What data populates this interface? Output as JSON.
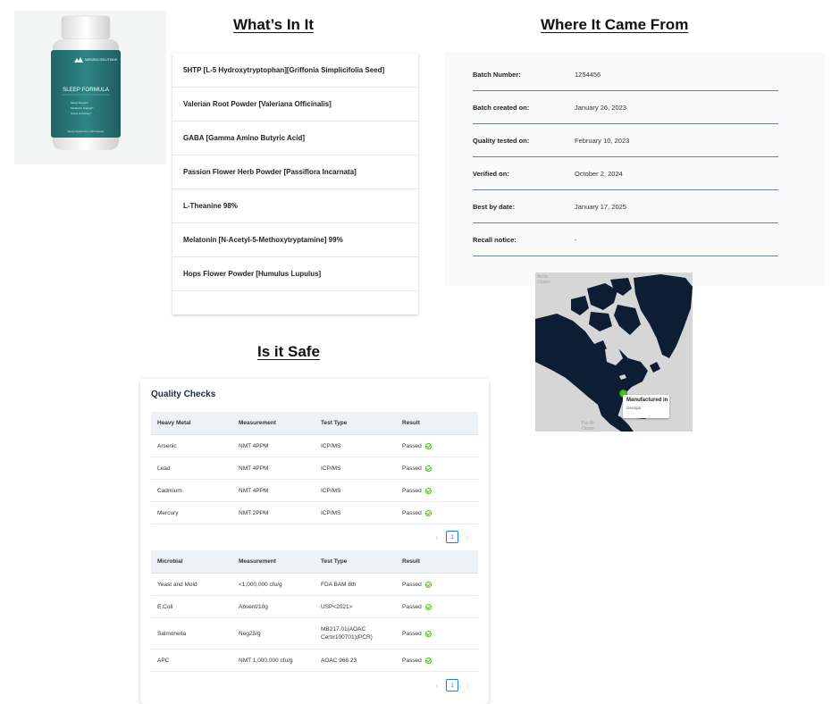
{
  "product": {
    "brand": "NATURAL SOLUTIONS",
    "name": "SLEEP FORMULA",
    "benefits": [
      "Sleep Support*",
      "Melatonin Support*",
      "Stress & Anxiety*"
    ],
    "footer": "Dietary Supplement | 120 Capsules",
    "colors": {
      "label": "#2a7a7a",
      "cap": "#f2f2f2"
    }
  },
  "headings": {
    "whats_in_it": "What’s In It",
    "where_it_came_from": "Where It Came From",
    "is_it_safe": "Is it Safe"
  },
  "ingredients": [
    "5HTP [L-5 Hydroxytryptophan][Griffonia Simplicifolia Seed]",
    "Valerian Root Powder [Valeriana Officinalis]",
    "GABA [Gamma Amino Butyric Acid]",
    "Passion Flower Herb Powder [Passiflora Incarnata]",
    "L-Theanine 98%",
    "Melatonin [N-Acetyl-5-Methoxytryptamine] 99%",
    "Hops Flower Powder [Humulus Lupulus]"
  ],
  "origin": [
    {
      "label": "Batch Number:",
      "value": "1254456"
    },
    {
      "label": "Batch created on:",
      "value": "January 26, 2023"
    },
    {
      "label": "Quality tested on:",
      "value": "February 10, 2023"
    },
    {
      "label": "Verified on:",
      "value": "October 2, 2024"
    },
    {
      "label": "Best by date:",
      "value": "January 17, 2025"
    },
    {
      "label": "Recall notice:",
      "value": "-"
    }
  ],
  "map": {
    "arctic_label": "Arctic Ocean",
    "pacific_label": "Pacific Ocean",
    "tooltip_title": "Manufactured in",
    "tooltip_location": "Georgia",
    "colors": {
      "land": "#0d1d33",
      "water": "#d6d6d6",
      "pin": "#47c41f"
    }
  },
  "quality_checks": {
    "title": "Quality Checks",
    "heavy_metal_table": {
      "headers": [
        "Heavy Metal",
        "Measurement",
        "Test Type",
        "Result"
      ],
      "rows": [
        [
          "Arsenic",
          "NMT 4PPM",
          "ICP/MS",
          "Passed"
        ],
        [
          "Lead",
          "NMT 4PPM",
          "ICP/MS",
          "Passed"
        ],
        [
          "Cadmium",
          "NMT 4PPM",
          "ICP/MS",
          "Passed"
        ],
        [
          "Mercury",
          "NMT 2PPM",
          "ICP/MS",
          "Passed"
        ]
      ],
      "page": "1"
    },
    "microbial_table": {
      "headers": [
        "Microbial",
        "Measurement",
        "Test Type",
        "Result"
      ],
      "rows": [
        [
          "Yeast and Mold",
          "<1,000,000 cfu/g",
          "FDA BAM 8th",
          "Passed"
        ],
        [
          "E.Coli",
          "Absent/10g",
          "USP<2021>",
          "Passed"
        ],
        [
          "Salmonella",
          "Neg25/g",
          "MB217.01(AOAC Cert#100701)(PCR)",
          "Passed"
        ],
        [
          "APC",
          "NMT 1,000,000 cfu/g",
          "AOAC 966.23",
          "Passed"
        ]
      ],
      "page": "1"
    },
    "colors": {
      "passed": "#52c41a",
      "pager_active": "#1677ff"
    }
  }
}
